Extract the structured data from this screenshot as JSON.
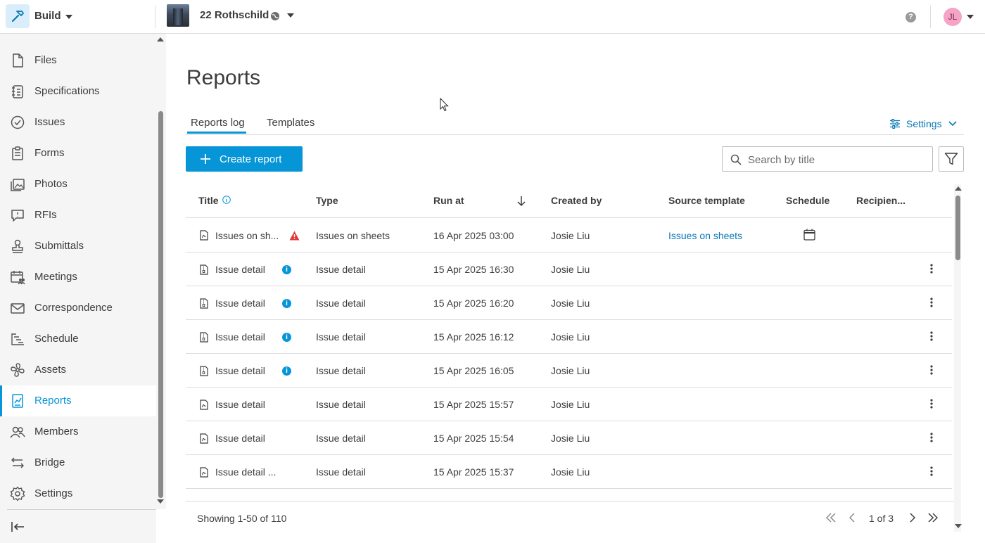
{
  "header": {
    "app_name": "Build",
    "project_name": "22 Rothschild",
    "help_label": "?",
    "user_initials": "JL"
  },
  "sidebar": {
    "items": [
      {
        "label": "Files",
        "icon": "file-icon"
      },
      {
        "label": "Specifications",
        "icon": "specifications-icon"
      },
      {
        "label": "Issues",
        "icon": "issues-check-icon"
      },
      {
        "label": "Forms",
        "icon": "forms-clipboard-icon"
      },
      {
        "label": "Photos",
        "icon": "photos-icon"
      },
      {
        "label": "RFIs",
        "icon": "rfi-chat-icon"
      },
      {
        "label": "Submittals",
        "icon": "submittals-stamp-icon"
      },
      {
        "label": "Meetings",
        "icon": "meetings-calendar-icon"
      },
      {
        "label": "Correspondence",
        "icon": "correspondence-mail-icon"
      },
      {
        "label": "Schedule",
        "icon": "schedule-gantt-icon"
      },
      {
        "label": "Assets",
        "icon": "assets-fan-icon"
      },
      {
        "label": "Reports",
        "icon": "reports-chart-icon",
        "active": true
      },
      {
        "label": "Members",
        "icon": "members-icon"
      },
      {
        "label": "Bridge",
        "icon": "bridge-arrows-icon"
      },
      {
        "label": "Settings",
        "icon": "settings-gear-icon"
      }
    ]
  },
  "main": {
    "title": "Reports",
    "tabs": [
      {
        "label": "Reports log",
        "active": true
      },
      {
        "label": "Templates",
        "active": false
      }
    ],
    "settings_label": "Settings",
    "create_button_label": "Create report",
    "search": {
      "placeholder": "Search by title",
      "value": ""
    }
  },
  "table": {
    "columns": [
      "Title",
      "Type",
      "Run at",
      "Created by",
      "Source template",
      "Schedule",
      "Recipien..."
    ],
    "sort_column": "Run at",
    "sort_direction": "descending",
    "rows": [
      {
        "title": "Issues on sh...",
        "badge": "warning",
        "type": "Issues on sheets",
        "run_at": "16 Apr 2025 03:00",
        "created_by": "Josie Liu",
        "source_template": "Issues on sheets",
        "schedule": "calendar-icon",
        "recipients": ""
      },
      {
        "title": "Issue detail",
        "badge": "info",
        "type": "Issue detail",
        "run_at": "15 Apr 2025 16:30",
        "created_by": "Josie Liu",
        "source_template": "",
        "schedule": "",
        "recipients": ""
      },
      {
        "title": "Issue detail",
        "badge": "info",
        "type": "Issue detail",
        "run_at": "15 Apr 2025 16:20",
        "created_by": "Josie Liu",
        "source_template": "",
        "schedule": "",
        "recipients": ""
      },
      {
        "title": "Issue detail",
        "badge": "info",
        "type": "Issue detail",
        "run_at": "15 Apr 2025 16:12",
        "created_by": "Josie Liu",
        "source_template": "",
        "schedule": "",
        "recipients": ""
      },
      {
        "title": "Issue detail",
        "badge": "info",
        "type": "Issue detail",
        "run_at": "15 Apr 2025 16:05",
        "created_by": "Josie Liu",
        "source_template": "",
        "schedule": "",
        "recipients": ""
      },
      {
        "title": "Issue detail",
        "badge": "",
        "type": "Issue detail",
        "run_at": "15 Apr 2025 15:57",
        "created_by": "Josie Liu",
        "source_template": "",
        "schedule": "",
        "recipients": ""
      },
      {
        "title": "Issue detail",
        "badge": "",
        "type": "Issue detail",
        "run_at": "15 Apr 2025 15:54",
        "created_by": "Josie Liu",
        "source_template": "",
        "schedule": "",
        "recipients": ""
      },
      {
        "title": "Issue detail ...",
        "badge": "",
        "type": "Issue detail",
        "run_at": "15 Apr 2025 15:37",
        "created_by": "Josie Liu",
        "source_template": "",
        "schedule": "",
        "recipients": ""
      }
    ]
  },
  "footer": {
    "showing_text": "Showing 1-50 of 110",
    "page_text": "1 of 3"
  },
  "colors": {
    "accent": "#0696d7",
    "link": "#0677b5",
    "warning": "#e03b3b",
    "sidebar_bg": "#f5f5f5"
  }
}
